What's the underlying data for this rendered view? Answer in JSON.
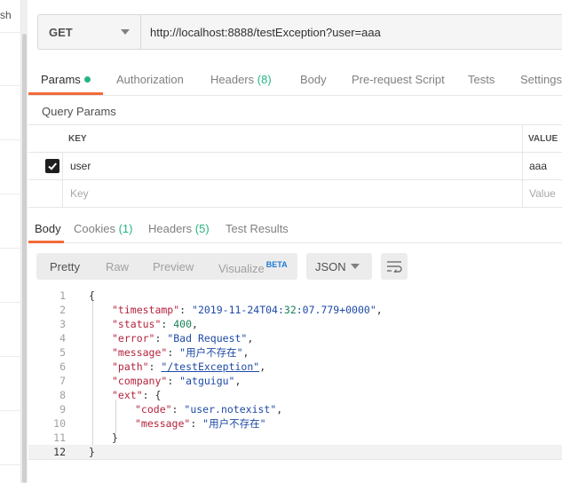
{
  "sidebar": {
    "stub_text": "sh"
  },
  "request": {
    "method": "GET",
    "url": "http://localhost:8888/testException?user=aaa"
  },
  "request_tabs": [
    {
      "label": "Params",
      "count": ""
    },
    {
      "label": "Authorization",
      "count": ""
    },
    {
      "label": "Headers",
      "count": "(8)"
    },
    {
      "label": "Body",
      "count": ""
    },
    {
      "label": "Pre-request Script",
      "count": ""
    },
    {
      "label": "Tests",
      "count": ""
    },
    {
      "label": "Settings",
      "count": ""
    }
  ],
  "query_params": {
    "title": "Query Params",
    "headers": {
      "key": "KEY",
      "value": "VALUE"
    },
    "rows": [
      {
        "checked": true,
        "key": "user",
        "value": "aaa"
      }
    ],
    "placeholder": {
      "key": "Key",
      "value": "Value"
    }
  },
  "response_tabs": [
    {
      "label": "Body",
      "count": ""
    },
    {
      "label": "Cookies",
      "count": "(1)"
    },
    {
      "label": "Headers",
      "count": "(5)"
    },
    {
      "label": "Test Results",
      "count": ""
    }
  ],
  "view_modes": [
    "Pretty",
    "Raw",
    "Preview",
    "Visualize"
  ],
  "beta_label": "BETA",
  "format": "JSON",
  "code": {
    "line_numbers": [
      "1",
      "2",
      "3",
      "4",
      "5",
      "6",
      "7",
      "8",
      "9",
      "10",
      "11",
      "12"
    ],
    "lines": [
      "{",
      "\"timestamp\": \"2019-11-24T04:32:07.779+0000\",",
      "\"status\": 400,",
      "\"error\": \"Bad Request\",",
      "\"message\": \"用户不存在\",",
      "\"path\": \"/testException\",",
      "\"company\": \"atguigu\",",
      "\"ext\": {",
      "\"code\": \"user.notexist\",",
      "\"message\": \"用户不存在\"",
      "}",
      "}"
    ]
  },
  "colors": {
    "accent": "#f26b3a",
    "count_green": "#26b47f",
    "json_key": "#b4233c",
    "json_string": "#1f4aa6"
  }
}
